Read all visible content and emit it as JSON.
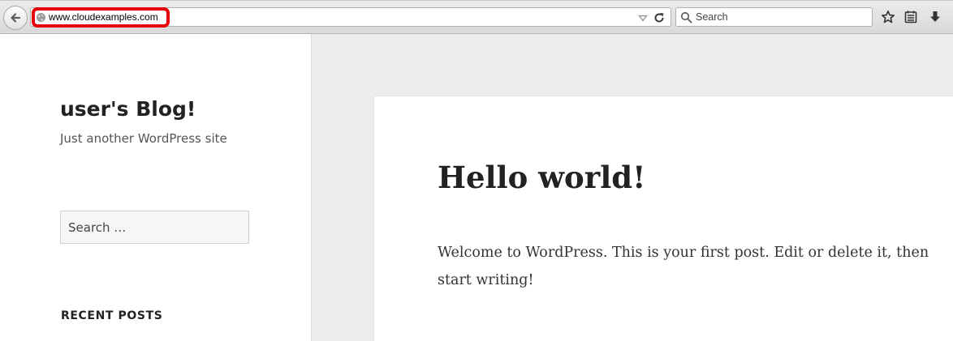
{
  "browser": {
    "url": "www.cloudexamples.com",
    "search_placeholder": "Search",
    "icons": {
      "back": "back-arrow-icon",
      "site": "globe-icon",
      "dropdown": "dropdown-arrow-icon",
      "reload": "reload-icon",
      "search": "search-icon",
      "bookmark": "star-icon",
      "reader": "reading-list-icon",
      "download": "download-icon"
    },
    "highlight_color": "#e8000b"
  },
  "sidebar": {
    "site_title": "user's Blog!",
    "site_description": "Just another WordPress site",
    "search_placeholder": "Search …",
    "widget_title": "RECENT POSTS"
  },
  "post": {
    "title": "Hello world!",
    "body": "Welcome to WordPress. This is your first post. Edit or delete it, then start writing!"
  }
}
